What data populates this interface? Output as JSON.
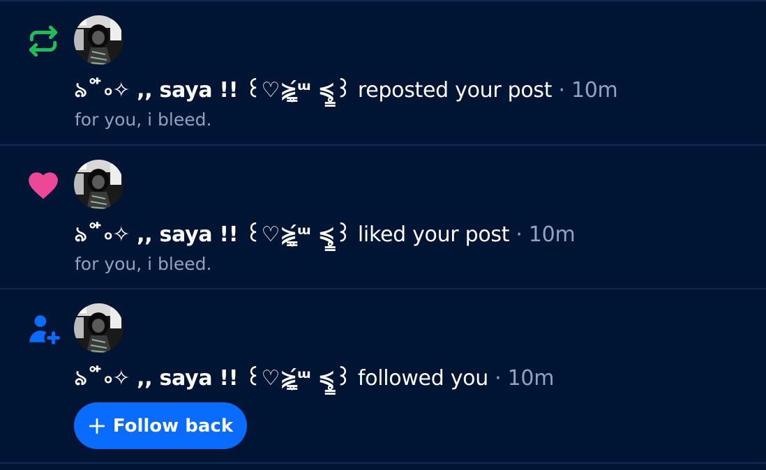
{
  "colors": {
    "background": "#001433",
    "divider": "#0d2a52",
    "repost_icon": "#20bc5a",
    "like_icon": "#ec4899",
    "follow_icon": "#0a6cff",
    "button": "#0a6cff",
    "muted_text": "#8fa3c2"
  },
  "notifications": [
    {
      "type": "repost",
      "icon": "repost-icon",
      "author": "৯˚ ໋৹✧ ,, saya !! ꒰♡≽̳̥́ᵚ ≼̥̳꒱",
      "action": " reposted your post",
      "separator": " · ",
      "time": "10m",
      "snippet": "for you, i bleed."
    },
    {
      "type": "like",
      "icon": "heart-icon",
      "author": "৯˚ ໋৹✧ ,, saya !! ꒰♡≽̳̥́ᵚ ≼̥̳꒱",
      "action": " liked your post",
      "separator": " · ",
      "time": "10m",
      "snippet": "for you, i bleed."
    },
    {
      "type": "follow",
      "icon": "person-add-icon",
      "author": "৯˚ ໋৹✧ ,, saya !! ꒰♡≽̳̥́ᵚ ≼̥̳꒱",
      "action": " followed you",
      "separator": " · ",
      "time": "10m",
      "button_label": "Follow back"
    }
  ]
}
